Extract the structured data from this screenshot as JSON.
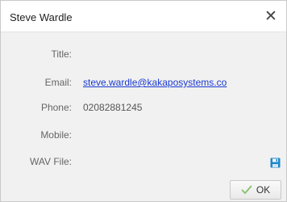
{
  "window": {
    "title": "Steve Wardle",
    "close_glyph": "✕"
  },
  "fields": {
    "title": {
      "label": "Title:",
      "value": ""
    },
    "email": {
      "label": "Email:",
      "value": "steve.wardle@kakaposystems.co"
    },
    "phone": {
      "label": "Phone:",
      "value": "02082881245"
    },
    "mobile": {
      "label": "Mobile:",
      "value": ""
    },
    "wav": {
      "label": "WAV File:",
      "value": ""
    }
  },
  "icons": {
    "save": "floppy-save-icon",
    "check": "checkmark-icon"
  },
  "colors": {
    "link": "#1a3ad1",
    "save_icon": "#1e86c9",
    "check": "#86c06a"
  },
  "buttons": {
    "ok_label": "OK"
  }
}
